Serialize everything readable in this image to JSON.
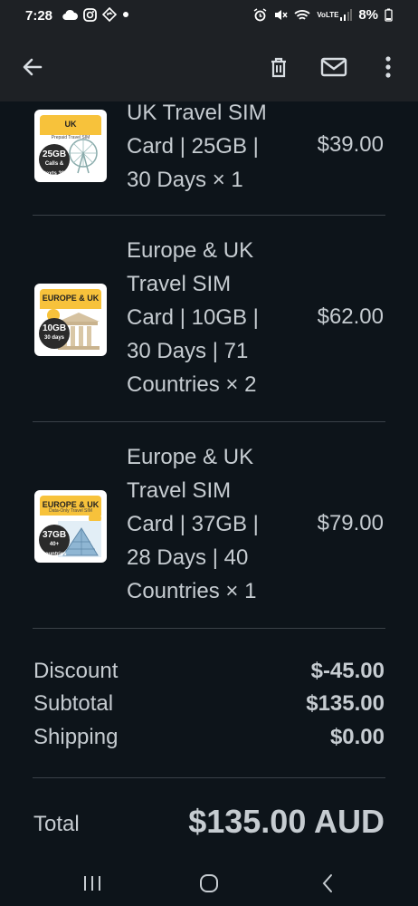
{
  "status_bar": {
    "time": "7:28",
    "battery": "8%",
    "network": "VoLTE"
  },
  "app_bar": {
    "icons": [
      "back-arrow-icon",
      "trash-icon",
      "mail-icon",
      "more-vert-icon"
    ]
  },
  "items": [
    {
      "name_lines": [
        "UK Travel SIM",
        "Card | 25GB |",
        "30 Days × 1"
      ],
      "price": "$39.00",
      "thumb": {
        "header": "UK",
        "sub": "Prepaid Travel SIM",
        "badge": "25GB",
        "badge_sub": "Calls & texts 30 days",
        "color": "#f7c23b"
      }
    },
    {
      "name_lines": [
        "Europe & UK",
        "Travel SIM",
        "Card | 10GB |",
        "30 Days | 71",
        "Countries × 2"
      ],
      "price": "$62.00",
      "thumb": {
        "header": "EUROPE & UK",
        "badge": "10GB",
        "badge_sub": "30 days",
        "color": "#f7c23b"
      }
    },
    {
      "name_lines": [
        "Europe & UK",
        "Travel SIM",
        "Card | 37GB |",
        "28 Days | 40",
        "Countries × 1"
      ],
      "price": "$79.00",
      "thumb": {
        "header": "EUROPE & UK",
        "sub": "Data-Only Travel SIM",
        "badge": "37GB",
        "badge_sub": "40+ countries 28 days",
        "color": "#f7c23b"
      }
    }
  ],
  "summary": {
    "discount_label": "Discount",
    "discount_value": "$-45.00",
    "subtotal_label": "Subtotal",
    "subtotal_value": "$135.00",
    "shipping_label": "Shipping",
    "shipping_value": "$0.00",
    "total_label": "Total",
    "total_value": "$135.00 AUD"
  },
  "colors": {
    "background": "#0d141a",
    "app_bar": "#1e2125",
    "text": "#c6ccd1",
    "divider": "#3a4148"
  }
}
